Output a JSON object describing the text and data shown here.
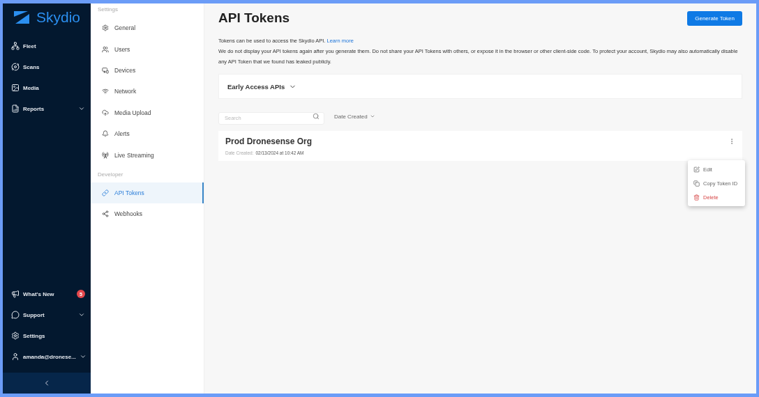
{
  "brand": "Skydio",
  "nav": [
    {
      "label": "Fleet",
      "expandable": false
    },
    {
      "label": "Scans",
      "expandable": false
    },
    {
      "label": "Media",
      "expandable": false
    },
    {
      "label": "Reports",
      "expandable": true
    }
  ],
  "nav_bottom": [
    {
      "label": "What's New",
      "badge": "5",
      "expandable": false
    },
    {
      "label": "Support",
      "expandable": true
    },
    {
      "label": "Settings",
      "expandable": false
    },
    {
      "label": "amanda@dronese...",
      "expandable": true
    }
  ],
  "settings_nav": [
    {
      "heading": "Settings",
      "items": [
        {
          "label": "General",
          "selected": false
        },
        {
          "label": "Users",
          "selected": false
        },
        {
          "label": "Devices",
          "selected": false
        },
        {
          "label": "Network",
          "selected": false
        },
        {
          "label": "Media Upload",
          "selected": false
        },
        {
          "label": "Alerts",
          "selected": false
        },
        {
          "label": "Live Streaming",
          "selected": false
        }
      ]
    },
    {
      "heading": "Developer",
      "items": [
        {
          "label": "API Tokens",
          "selected": true
        },
        {
          "label": "Webhooks",
          "selected": false
        }
      ]
    }
  ],
  "page": {
    "title": "API Tokens",
    "primary_button": "Generate Token",
    "intro": "Tokens can be used to access the Skydio API.",
    "intro_link": "Learn more",
    "notice": "We do not display your API tokens again after you generate them. Do not share your API Tokens with others, or expose it in the browser or other client-side code. To protect your account, Skydio may also automatically disable any API Token that we found has leaked publicly.",
    "early_access": {
      "label": "Early Access APIs",
      "expanded": false
    },
    "search": {
      "placeholder": "Search"
    },
    "sort": "Date Created",
    "tokens": [
      {
        "name": "Prod Dronesense Org",
        "date_label": "Date Created:",
        "date": "02/13/2024 at 10:42 AM"
      }
    ],
    "menu": [
      {
        "label": "Edit",
        "danger": false
      },
      {
        "label": "Copy Token ID",
        "danger": false
      },
      {
        "label": "Delete",
        "danger": true
      }
    ]
  }
}
